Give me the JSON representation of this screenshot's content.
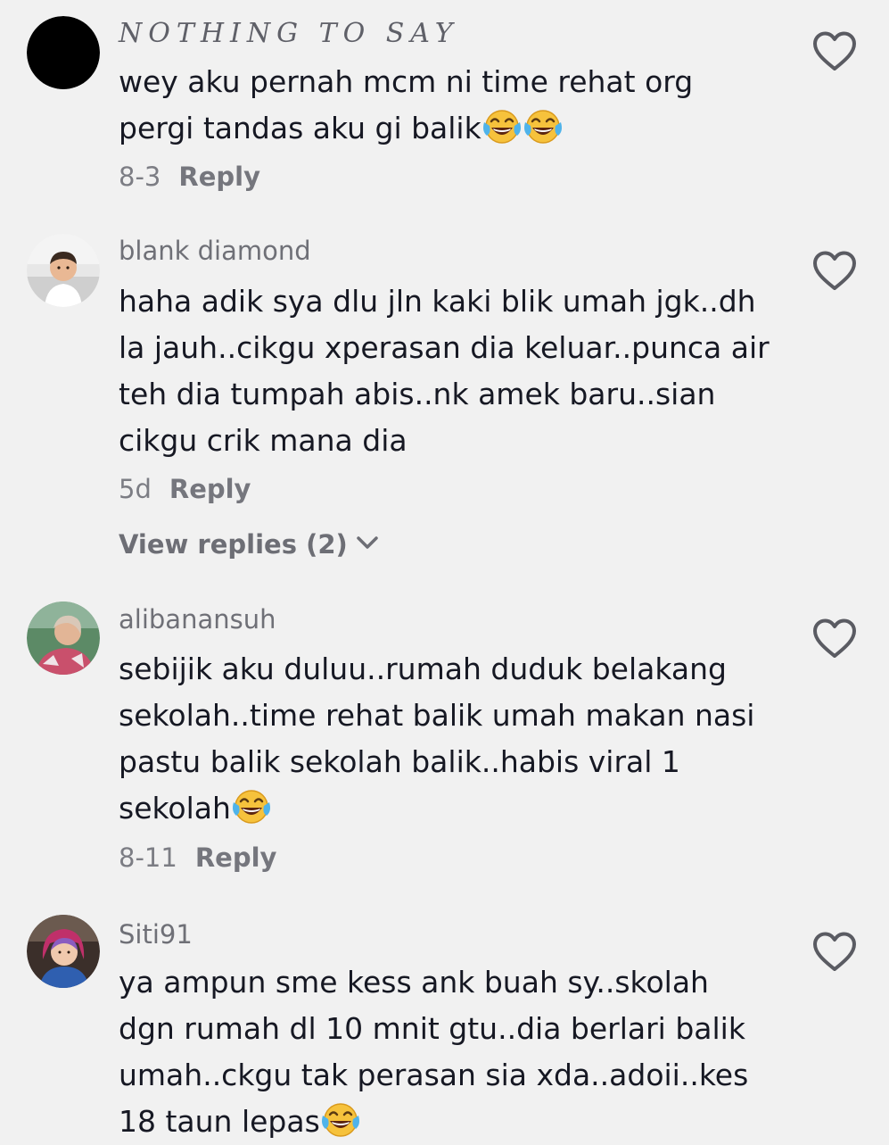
{
  "comments": [
    {
      "username": "NOTHING TO SAY",
      "text_lines": [
        "wey aku pernah mcm ni time rehat org",
        "pergi tandas aku gi balik"
      ],
      "emojis": [
        "face-with-tears-of-joy-emoji",
        "face-with-tears-of-joy-emoji"
      ],
      "date": "8-3",
      "reply_label": "Reply"
    },
    {
      "username": "blank diamond",
      "text_lines": [
        "haha adik sya dlu jln kaki blik umah jgk..dh",
        "la jauh..cikgu xperasan dia keluar..punca air",
        "teh dia tumpah abis..nk amek baru..sian",
        "cikgu crik mana dia"
      ],
      "date": "5d",
      "reply_label": "Reply",
      "view_replies_label": "View replies (2)"
    },
    {
      "username": "alibanansuh",
      "text_lines": [
        "sebijik aku duluu..rumah duduk belakang",
        "sekolah..time rehat balik umah makan nasi",
        "pastu balik sekolah balik..habis viral 1",
        "sekolah"
      ],
      "emojis": [
        "face-with-tears-of-joy-emoji"
      ],
      "date": "8-11",
      "reply_label": "Reply"
    },
    {
      "username": "Siti91",
      "text_lines": [
        "ya ampun sme kess ank buah sy..skolah",
        "dgn rumah dl 10 mnit gtu..dia berlari balik",
        "umah..ckgu tak perasan sia xda..adoii..kes",
        "18 taun lepas"
      ],
      "emojis": [
        "face-with-tears-of-joy-emoji"
      ]
    }
  ],
  "icons": {
    "like": "heart-outline-icon",
    "expand": "chevron-down-icon"
  },
  "colors": {
    "background": "#f1f1f1",
    "text": "#161823",
    "secondary": "#7c7d84"
  }
}
